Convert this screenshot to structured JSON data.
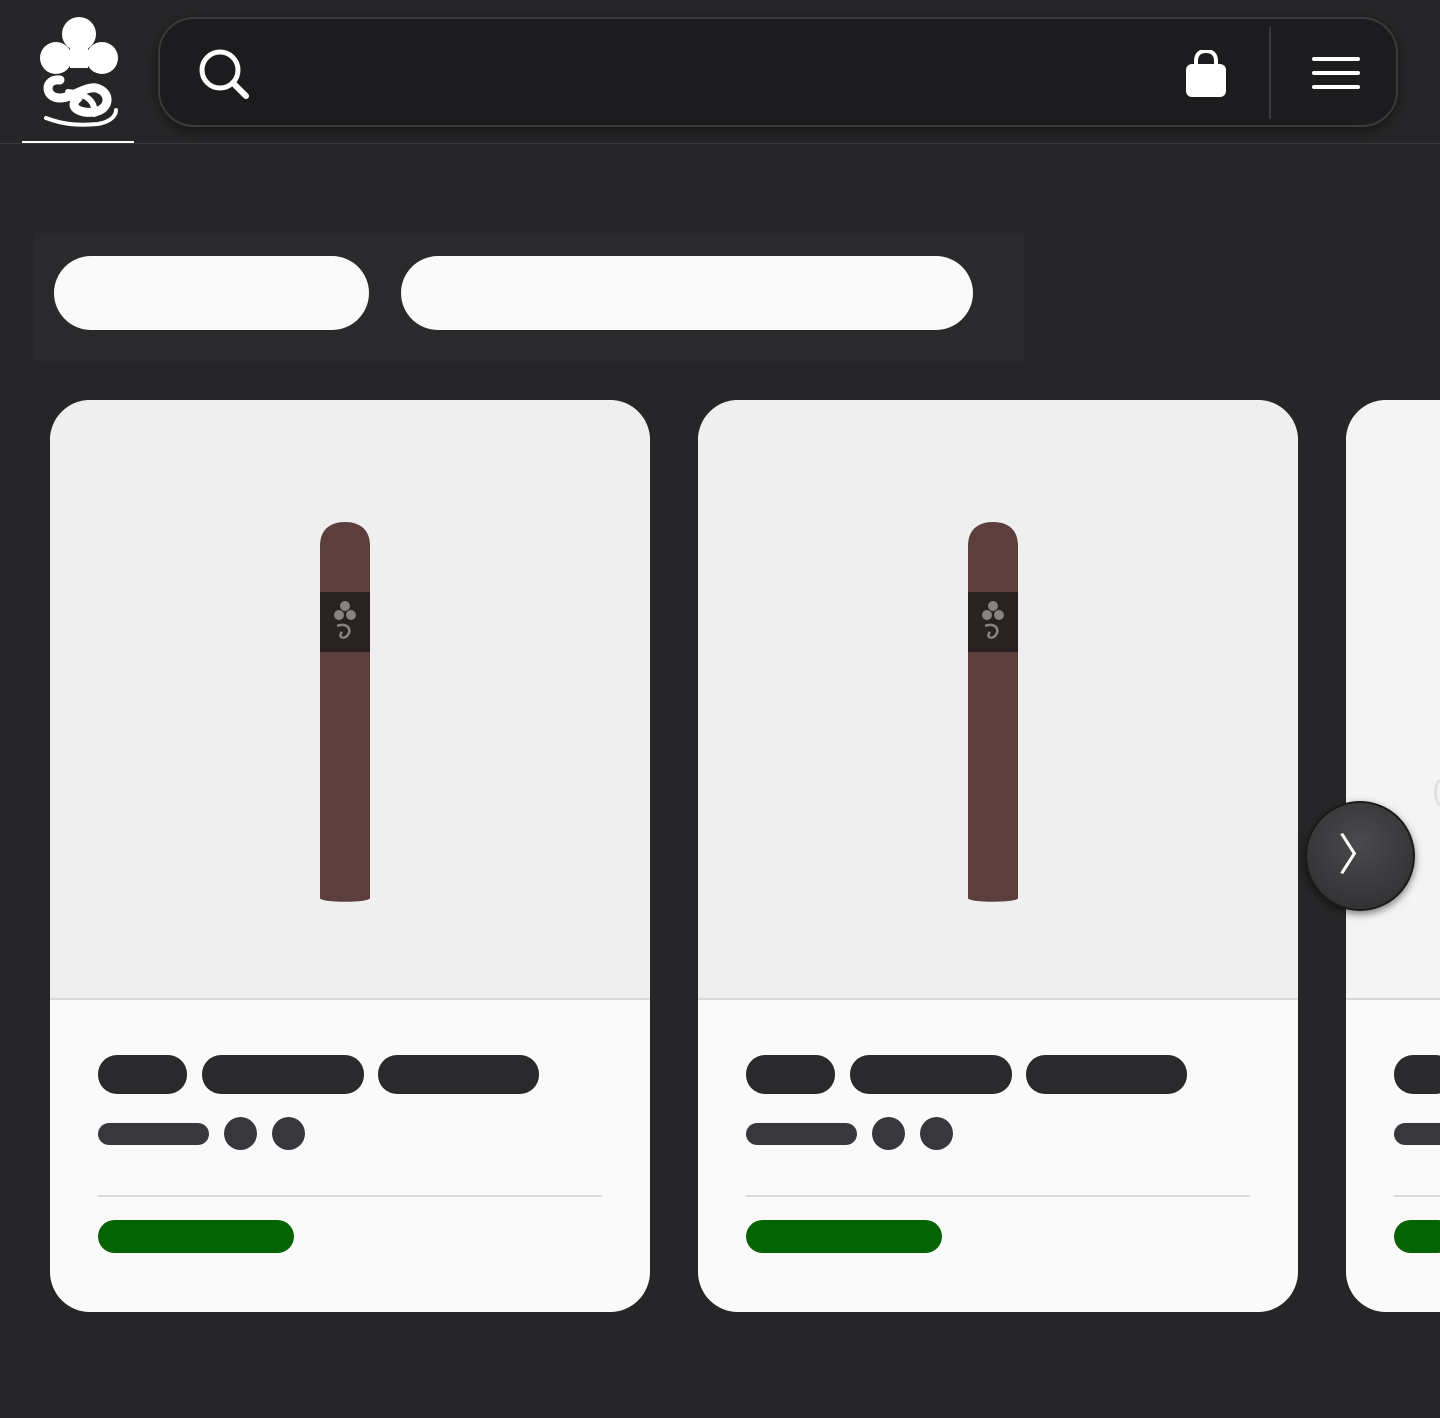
{
  "header": {
    "logo_icon": "club-ampersand-logo-icon",
    "search_placeholder": "",
    "icons": [
      "search-icon",
      "shopping-bag-icon",
      "hamburger-menu-icon"
    ]
  },
  "filters": {
    "pills": [
      "",
      ""
    ]
  },
  "products": [
    {
      "image_icon": "cigar-icon",
      "name": "",
      "price": ""
    },
    {
      "image_icon": "cigar-icon",
      "name": "",
      "price": ""
    },
    {
      "image_icon": "cigar-icon",
      "name": "",
      "price": ""
    }
  ],
  "carousel": {
    "next_label": "〉"
  },
  "colors": {
    "background": "#262628",
    "search_bg": "#1c1c1e",
    "card_bg": "#fafafa",
    "card_image_bg": "#efefef",
    "skeleton_dark": "#2a2a2c",
    "skeleton_gray": "#38383c",
    "price_green": "#046404",
    "cigar_brown": "#5c3e3c",
    "cigar_band": "#2a2222"
  }
}
